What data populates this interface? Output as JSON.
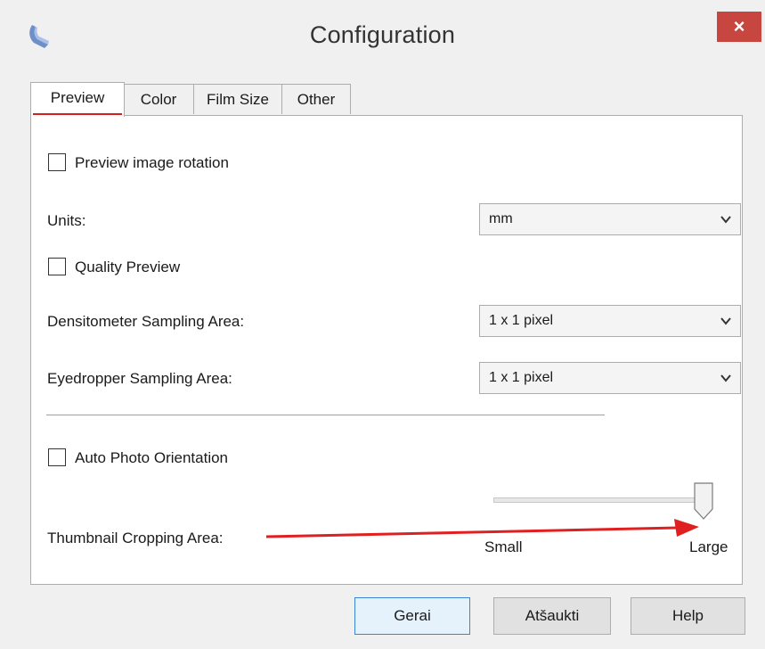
{
  "window": {
    "title": "Configuration",
    "close_glyph": "×",
    "icon": "scanner-app-icon"
  },
  "tabs": [
    {
      "label": "Preview",
      "active": true
    },
    {
      "label": "Color",
      "active": false
    },
    {
      "label": "Film Size",
      "active": false
    },
    {
      "label": "Other",
      "active": false
    }
  ],
  "preview": {
    "preview_image_rotation": {
      "label": "Preview image rotation",
      "checked": false
    },
    "units": {
      "label": "Units:",
      "value": "mm"
    },
    "quality_preview": {
      "label": "Quality Preview",
      "checked": false
    },
    "densitometer": {
      "label": "Densitometer Sampling Area:",
      "value": "1 x 1 pixel"
    },
    "eyedropper": {
      "label": "Eyedropper Sampling Area:",
      "value": "1 x 1 pixel"
    },
    "auto_photo_orientation": {
      "label": "Auto Photo Orientation",
      "checked": false
    },
    "thumbnail_cropping": {
      "label": "Thumbnail Cropping Area:",
      "min_label": "Small",
      "max_label": "Large",
      "level": 1.0
    }
  },
  "buttons": {
    "ok": "Gerai",
    "cancel": "Atšaukti",
    "help": "Help"
  },
  "colors": {
    "close_bg": "#c7463f",
    "tab_underline": "#d61f1f",
    "annotation_arrow": "#e02020",
    "default_button_border": "#3a86d4"
  }
}
